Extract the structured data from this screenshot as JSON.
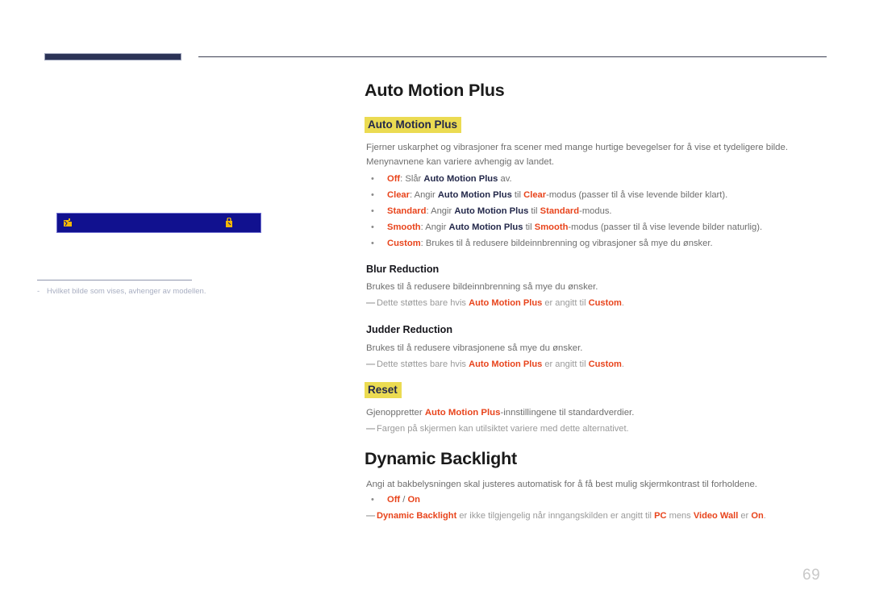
{
  "page": {
    "number": "69",
    "language": "Norwegian"
  },
  "left_panel": {
    "image_placeholder": {
      "icon_left": "broken-image-icon",
      "icon_right": "broken-image-icon",
      "background_color": "#11118f",
      "icon_color": "#f2b705"
    },
    "footnote": {
      "marker": "-",
      "text": "Hvilket bilde som vises, avhenger av modellen."
    }
  },
  "content": {
    "section1": {
      "title": "Auto Motion Plus",
      "highlight_heading": "Auto Motion Plus",
      "paragraphs": [
        "Fjerner uskarphet og vibrasjoner fra scener med mange hurtige bevegelser for å vise et tydeligere bilde.",
        "Menynavnene kan variere avhengig av landet."
      ],
      "bullets": [
        {
          "keyword": "Off",
          "sep": ": ",
          "parts": [
            {
              "text": "Slår ",
              "style": "gray"
            },
            {
              "text": "Auto Motion Plus",
              "style": "navy"
            },
            {
              "text": " av.",
              "style": "gray"
            }
          ]
        },
        {
          "keyword": "Clear",
          "sep": ": ",
          "parts": [
            {
              "text": "Angir ",
              "style": "gray"
            },
            {
              "text": "Auto Motion Plus",
              "style": "navy"
            },
            {
              "text": " til ",
              "style": "gray"
            },
            {
              "text": "Clear",
              "style": "orange"
            },
            {
              "text": "-modus (passer til å vise levende bilder klart).",
              "style": "gray"
            }
          ]
        },
        {
          "keyword": "Standard",
          "sep": ": ",
          "parts": [
            {
              "text": "Angir ",
              "style": "gray"
            },
            {
              "text": "Auto Motion Plus",
              "style": "navy"
            },
            {
              "text": " til ",
              "style": "gray"
            },
            {
              "text": "Standard",
              "style": "orange"
            },
            {
              "text": "-modus.",
              "style": "gray"
            }
          ]
        },
        {
          "keyword": "Smooth",
          "sep": ": ",
          "parts": [
            {
              "text": "Angir ",
              "style": "gray"
            },
            {
              "text": "Auto Motion Plus",
              "style": "navy"
            },
            {
              "text": " til ",
              "style": "gray"
            },
            {
              "text": "Smooth",
              "style": "orange"
            },
            {
              "text": "-modus (passer til å vise levende bilder naturlig).",
              "style": "gray"
            }
          ]
        },
        {
          "keyword": "Custom",
          "sep": ": ",
          "parts": [
            {
              "text": "Brukes til å redusere bildeinnbrenning og vibrasjoner så mye du ønsker.",
              "style": "gray"
            }
          ]
        }
      ],
      "blur_reduction": {
        "heading": "Blur Reduction",
        "body": "Brukes til å redusere bildeinnbrenning så mye du ønsker.",
        "note": [
          {
            "text": "Dette støttes bare hvis ",
            "style": "gray-light"
          },
          {
            "text": "Auto Motion Plus",
            "style": "orange"
          },
          {
            "text": " er angitt til ",
            "style": "gray-light"
          },
          {
            "text": "Custom",
            "style": "orange"
          },
          {
            "text": ".",
            "style": "gray-light"
          }
        ]
      },
      "judder_reduction": {
        "heading": "Judder Reduction",
        "body": "Brukes til å redusere vibrasjonene så mye du ønsker.",
        "note": [
          {
            "text": "Dette støttes bare hvis ",
            "style": "gray-light"
          },
          {
            "text": "Auto Motion Plus",
            "style": "orange"
          },
          {
            "text": " er angitt til ",
            "style": "gray-light"
          },
          {
            "text": "Custom",
            "style": "orange"
          },
          {
            "text": ".",
            "style": "gray-light"
          }
        ]
      },
      "reset": {
        "highlight_heading": "Reset",
        "body": [
          {
            "text": "Gjenoppretter ",
            "style": "gray"
          },
          {
            "text": "Auto Motion Plus",
            "style": "orange"
          },
          {
            "text": "-innstillingene til standardverdier.",
            "style": "gray"
          }
        ],
        "note": [
          {
            "text": "Fargen på skjermen kan utilsiktet variere med dette alternativet.",
            "style": "gray-light"
          }
        ]
      }
    },
    "section2": {
      "title": "Dynamic Backlight",
      "paragraph": "Angi at bakbelysningen skal justeres automatisk for å få best mulig skjermkontrast til forholdene.",
      "bullet": {
        "parts": [
          {
            "text": "Off",
            "style": "orange"
          },
          {
            "text": " / ",
            "style": "gray"
          },
          {
            "text": "On",
            "style": "orange"
          }
        ]
      },
      "note": [
        {
          "text": "Dynamic Backlight",
          "style": "orange"
        },
        {
          "text": " er ikke tilgjengelig når inngangskilden er angitt til ",
          "style": "gray-light"
        },
        {
          "text": "PC",
          "style": "orange"
        },
        {
          "text": " mens ",
          "style": "gray-light"
        },
        {
          "text": "Video Wall",
          "style": "orange"
        },
        {
          "text": " er ",
          "style": "gray-light"
        },
        {
          "text": "On",
          "style": "orange"
        },
        {
          "text": ".",
          "style": "gray-light"
        }
      ]
    }
  },
  "colors": {
    "navy_bar": "#2b3356",
    "highlight_yellow": "#ebdb52",
    "keyword_orange": "#e8441c",
    "heading_navy": "#23284a",
    "placeholder_blue": "#11118f"
  }
}
